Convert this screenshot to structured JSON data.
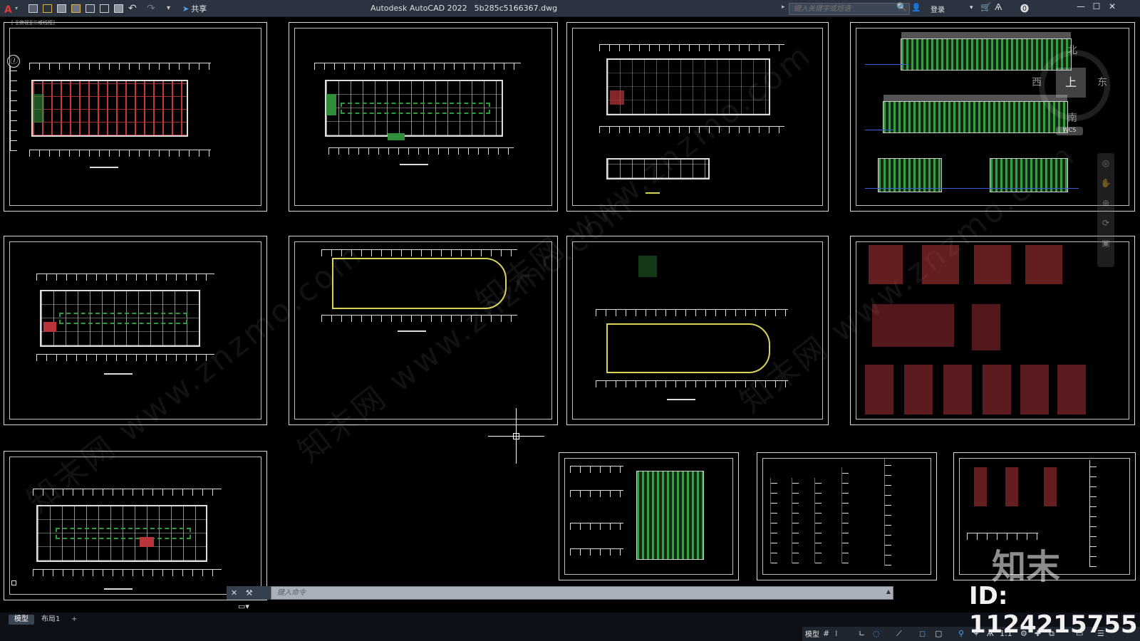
{
  "titlebar": {
    "app_icon": "A",
    "app_menu_chevron": "▾",
    "share_label": "共享",
    "app_title": "Autodesk AutoCAD 2022",
    "file_name": "5b285c5166367.dwg",
    "search_placeholder": "键入关键字或短语",
    "login_label": "登录",
    "icons": [
      "new-icon",
      "open-icon",
      "save-icon",
      "save-as-icon",
      "publish-icon",
      "plot-preview-icon",
      "print-icon",
      "undo-icon",
      "redo-icon",
      "customize-icon",
      "binoculars-icon",
      "user-icon",
      "cart-icon",
      "a360-icon",
      "help-icon"
    ]
  },
  "viewcube": {
    "top_label": "上",
    "west_label": "西",
    "east_label": "东",
    "south_label": "南",
    "north_label": "北",
    "wcs_label": "WCS"
  },
  "canvas": {
    "ucs_label": "Ⓘ",
    "watermark_text": "知末网 www.znzmo.com"
  },
  "command_line": {
    "close_icon": "✕",
    "customize_icon": "🔧",
    "placeholder": "键入命令"
  },
  "layout_tabs": [
    {
      "label": "模型",
      "active": true
    },
    {
      "label": "布局1",
      "active": false
    },
    {
      "label": "+",
      "active": false
    }
  ],
  "statusbar": {
    "model_label": "模型",
    "scale_label": "1:1",
    "icons": [
      "grid-icon",
      "snap-icon",
      "ortho-icon",
      "polar-icon",
      "isodraft-icon",
      "osnap-icon",
      "lineweight-icon",
      "transparency-icon",
      "selection-cycling-icon",
      "annotation-icon",
      "workspace-icon",
      "settings-icon",
      "isolate-icon",
      "fullscreen-icon",
      "menu-icon"
    ]
  },
  "id_label": "ID: 1124215755",
  "brand_watermark": "知末"
}
